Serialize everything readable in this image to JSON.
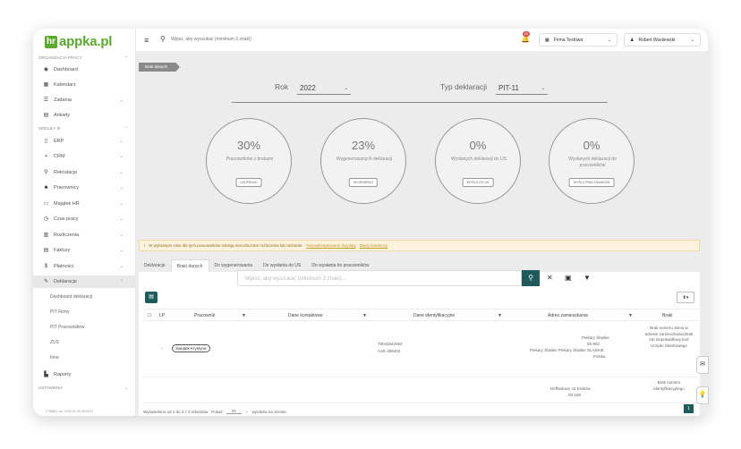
{
  "logo": {
    "mark": "hr",
    "text_a": "hr",
    "text_b": "appka.pl"
  },
  "sidebar": {
    "section1": "ORGANIZACJA PRACY",
    "section2": "MODUŁY ⚙",
    "section3": "USTAWIENIA",
    "items": [
      {
        "label": "Dashboard",
        "icon": "dashboard-icon",
        "glyph": "◉"
      },
      {
        "label": "Kalendarz",
        "icon": "calendar-icon",
        "glyph": "▦"
      },
      {
        "label": "Zadania",
        "icon": "tasks-icon",
        "glyph": "☰"
      },
      {
        "label": "Ankiety",
        "icon": "survey-icon",
        "glyph": "▤"
      },
      {
        "label": "ERP",
        "icon": "erp-icon",
        "glyph": "▯"
      },
      {
        "label": "CRM",
        "icon": "crm-icon",
        "glyph": "▪"
      },
      {
        "label": "Rekrutacje",
        "icon": "recruitment-icon",
        "glyph": "⚲"
      },
      {
        "label": "Pracownicy",
        "icon": "employees-icon",
        "glyph": "👥"
      },
      {
        "label": "Majątek HR",
        "icon": "assets-icon",
        "glyph": "▭"
      },
      {
        "label": "Czas pracy",
        "icon": "worktime-icon",
        "glyph": "◷"
      },
      {
        "label": "Rozliczenia",
        "icon": "settlements-icon",
        "glyph": "▥"
      },
      {
        "label": "Faktury",
        "icon": "invoices-icon",
        "glyph": "▤"
      },
      {
        "label": "Płatności",
        "icon": "payments-icon",
        "glyph": "$"
      },
      {
        "label": "Deklaracje",
        "icon": "declarations-icon",
        "glyph": "✎"
      },
      {
        "label": "Raporty",
        "icon": "reports-icon",
        "glyph": "▙"
      }
    ],
    "subitems": [
      "Dashboard deklaracji",
      "PIT Firmy",
      "PIT Pracowników",
      "ZUS",
      "Inne"
    ],
    "footer": "© 8888 | ver. 2024-01-09 08:33:57"
  },
  "topbar": {
    "search_placeholder": "Wpisz, aby wyszukać (minimum 3 znaki)",
    "badge_count": "99",
    "company": "Firma Testowa",
    "user": "Robert Wasilewski"
  },
  "main": {
    "breadcrumb": "Brak danych",
    "year_label": "Rok",
    "year_value": "2022",
    "type_label": "Typ deklaracji",
    "type_value": "PIT-11",
    "stats": [
      {
        "pct": "30%",
        "desc": "Pracowników z brakami",
        "btn": "UZUPEŁNIJ"
      },
      {
        "pct": "23%",
        "desc": "Wygenerowanych deklaracji",
        "btn": "WYGENERUJ"
      },
      {
        "pct": "0%",
        "desc": "Wysłanych deklaracji do US",
        "btn": "WYŚLIJ DO US"
      },
      {
        "pct": "0%",
        "desc": "Wysłanych deklaracji do pracowników",
        "btn": "WYŚLIJ PRACOWNIKOM"
      }
    ],
    "warning_text": "W wybranym roku dla tych pracowników istnieją nierozliczone rozliczenia lub rachunki.",
    "warning_link1": "Niezaakceptowane Wypłaty",
    "warning_link2": "Błędy Ewidencji",
    "tabs": [
      "Deklaracje",
      "Braki danych",
      "Do wygenerowania",
      "Do wysłania do US",
      "Do wysłania do pracowników"
    ],
    "table_search_placeholder": "Wpisz, aby wyszukać (minimum 3 znaki)...",
    "columns": [
      "LP",
      "Pracownik",
      "Dane kontaktowe",
      "Dane identyfikacyjne",
      "Adres zamieszkania",
      "Braki"
    ],
    "rows": [
      {
        "employee": "Świątek Krystyna",
        "ident_1": "78042642082",
        "ident_2": "AAE 458402",
        "addr_1": "Piekary Śląskie",
        "addr_2": "55-582",
        "addr_3": "Piekary Śląskie Piekary Śląskie ŚLĄSKIE",
        "addr_4": "Polska",
        "missing": "Brak numeru domu w adresie zamieszkania,Brak lub nieprawidłowy kod Urzędu Skarbowego"
      },
      {
        "employee": "",
        "ident_1": "",
        "ident_2": "",
        "addr_1": "Deffiadowy 42 Kraków",
        "addr_2": "00-168",
        "addr_3": "",
        "addr_4": "",
        "missing": "Brak numeru identyfikacyjnego"
      }
    ],
    "pager_text": "Wyświetlono od 1 do 3 z 3 rekordów",
    "pager_show": "Pokaż",
    "pager_size": "20",
    "pager_suffix": "wyników na stronie",
    "page_number": "1"
  },
  "colors": {
    "brand": "#5aaa2e",
    "accent": "#1f5b5a",
    "warning_bg": "#fbf3dd"
  }
}
